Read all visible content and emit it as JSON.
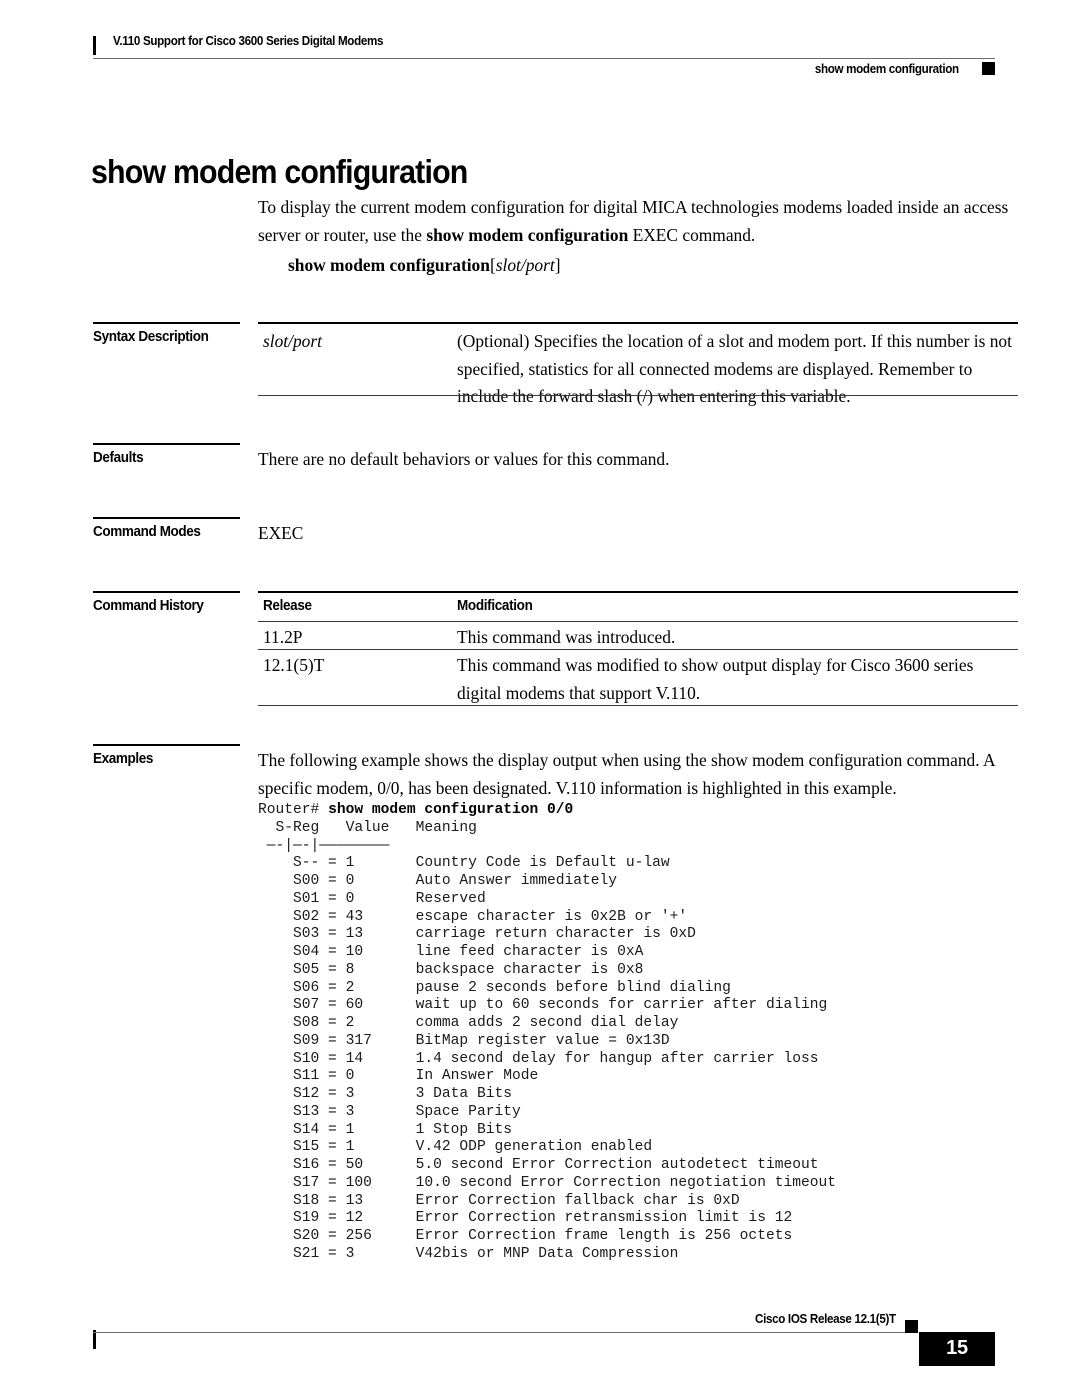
{
  "header": {
    "left_title": "V.110 Support for Cisco 3600 Series Digital Modems",
    "right_title": "show modem configuration"
  },
  "page_title": "show modem configuration",
  "intro": {
    "line1_a": "To display the current modem configuration for digital MICA technologies modems loaded inside an",
    "line2_a": "access server or router, use the ",
    "line2_bold": "show modem configuration",
    "line2_b": " EXEC command."
  },
  "syntax_line": {
    "command": "show modem configuration",
    "bracket_open": "[",
    "argument": "slot/port",
    "bracket_close": "]"
  },
  "sections": {
    "syntax_description": {
      "label": "Syntax Description",
      "param": "slot/port",
      "description_lines": [
        "(Optional) Specifies the location of a slot and modem port. If this number",
        "is not specified, statistics for all connected modems are displayed.",
        "Remember to include the forward slash (/) when entering this variable."
      ]
    },
    "defaults": {
      "label": "Defaults",
      "text": "There are no default behaviors or values for this command."
    },
    "command_modes": {
      "label": "Command Modes",
      "text": "EXEC"
    },
    "command_history": {
      "label": "Command History",
      "columns": [
        "Release",
        "Modification"
      ],
      "rows": [
        {
          "release": "11.2P",
          "modification_lines": [
            "This command was introduced."
          ]
        },
        {
          "release": "12.1(5)T",
          "modification_lines": [
            "This command was modified to show output display for Cisco 3600 series",
            "digital modems that support V.110."
          ]
        }
      ]
    },
    "examples": {
      "label": "Examples",
      "intro_lines": [
        "The following example shows the display output when using the show modem configuration command.",
        "A specific modem, 0/0, has been designated. V.110 information is highlighted in this example."
      ]
    }
  },
  "terminal": {
    "prompt": "Router# ",
    "command": "show modem configuration 0/0",
    "header_row": "  S-Reg   Value   Meaning",
    "separator_row": " —-|—-|————————",
    "registers": [
      {
        "reg": "S--",
        "value": "1",
        "meaning": "Country Code is Default u-law"
      },
      {
        "reg": "S00",
        "value": "0",
        "meaning": "Auto Answer immediately"
      },
      {
        "reg": "S01",
        "value": "0",
        "meaning": "Reserved"
      },
      {
        "reg": "S02",
        "value": "43",
        "meaning": "escape character is 0x2B or '+'"
      },
      {
        "reg": "S03",
        "value": "13",
        "meaning": "carriage return character is 0xD"
      },
      {
        "reg": "S04",
        "value": "10",
        "meaning": "line feed character is 0xA"
      },
      {
        "reg": "S05",
        "value": "8",
        "meaning": "backspace character is 0x8"
      },
      {
        "reg": "S06",
        "value": "2",
        "meaning": "pause 2 seconds before blind dialing"
      },
      {
        "reg": "S07",
        "value": "60",
        "meaning": "wait up to 60 seconds for carrier after dialing"
      },
      {
        "reg": "S08",
        "value": "2",
        "meaning": "comma adds 2 second dial delay"
      },
      {
        "reg": "S09",
        "value": "317",
        "meaning": "BitMap register value = 0x13D"
      },
      {
        "reg": "S10",
        "value": "14",
        "meaning": "1.4 second delay for hangup after carrier loss"
      },
      {
        "reg": "S11",
        "value": "0",
        "meaning": "In Answer Mode"
      },
      {
        "reg": "S12",
        "value": "3",
        "meaning": "3 Data Bits"
      },
      {
        "reg": "S13",
        "value": "3",
        "meaning": "Space Parity"
      },
      {
        "reg": "S14",
        "value": "1",
        "meaning": "1 Stop Bits"
      },
      {
        "reg": "S15",
        "value": "1",
        "meaning": "V.42 ODP generation enabled"
      },
      {
        "reg": "S16",
        "value": "50",
        "meaning": "5.0 second Error Correction autodetect timeout"
      },
      {
        "reg": "S17",
        "value": "100",
        "meaning": "10.0 second Error Correction negotiation timeout"
      },
      {
        "reg": "S18",
        "value": "13",
        "meaning": "Error Correction fallback char is 0xD"
      },
      {
        "reg": "S19",
        "value": "12",
        "meaning": "Error Correction retransmission limit is 12"
      },
      {
        "reg": "S20",
        "value": "256",
        "meaning": "Error Correction frame length is 256 octets"
      },
      {
        "reg": "S21",
        "value": "3",
        "meaning": "V42bis or MNP Data Compression"
      }
    ]
  },
  "footer": {
    "release": "Cisco IOS Release 12.1(5)T",
    "page_number": "15"
  },
  "colors": {
    "ink": "#000000",
    "rule": "#6e6e6e",
    "paper": "#ffffff"
  }
}
